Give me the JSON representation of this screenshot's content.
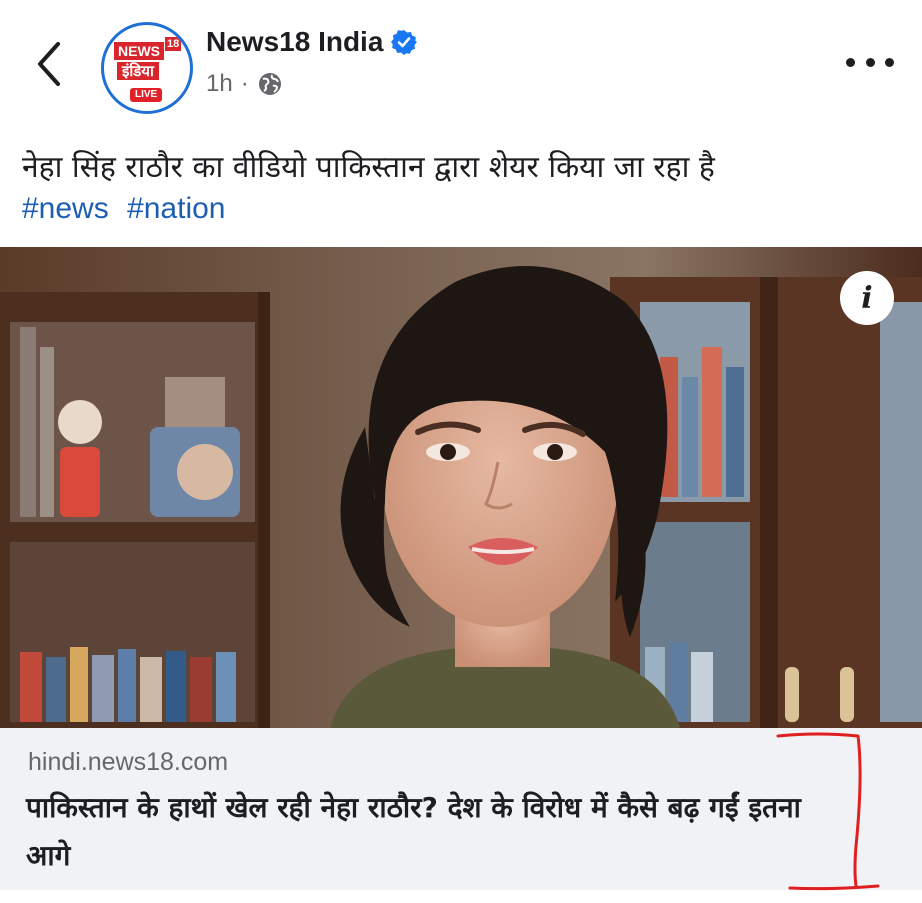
{
  "header": {
    "page_name": "News18 India",
    "timestamp": "1h",
    "separator": "·",
    "logo": {
      "news": "NEWS",
      "number": "18",
      "hindi": "इंडिया",
      "live": "LIVE"
    }
  },
  "post": {
    "caption": "नेहा सिंह राठौर का वीडियो पाकिस्तान द्वारा शेयर किया जा रहा है",
    "hashtags": [
      "#news",
      "#nation"
    ]
  },
  "link_card": {
    "domain": "hindi.news18.com",
    "title": "पाकिस्तान के हाथों खेल रही नेहा राठौर? देश के विरोध में कैसे बढ़ गईं इतना आगे"
  },
  "icons": {
    "back": "chevron-left-icon",
    "verified": "verified-badge-icon",
    "audience": "globe-icon",
    "more": "more-dots-icon",
    "info": "info-icon"
  },
  "colors": {
    "link_blue": "#1d5eb3",
    "verified_blue": "#1877f2",
    "brand_red": "#d8262c",
    "annotation_red": "#e02020",
    "card_bg": "#f0f2f5"
  }
}
